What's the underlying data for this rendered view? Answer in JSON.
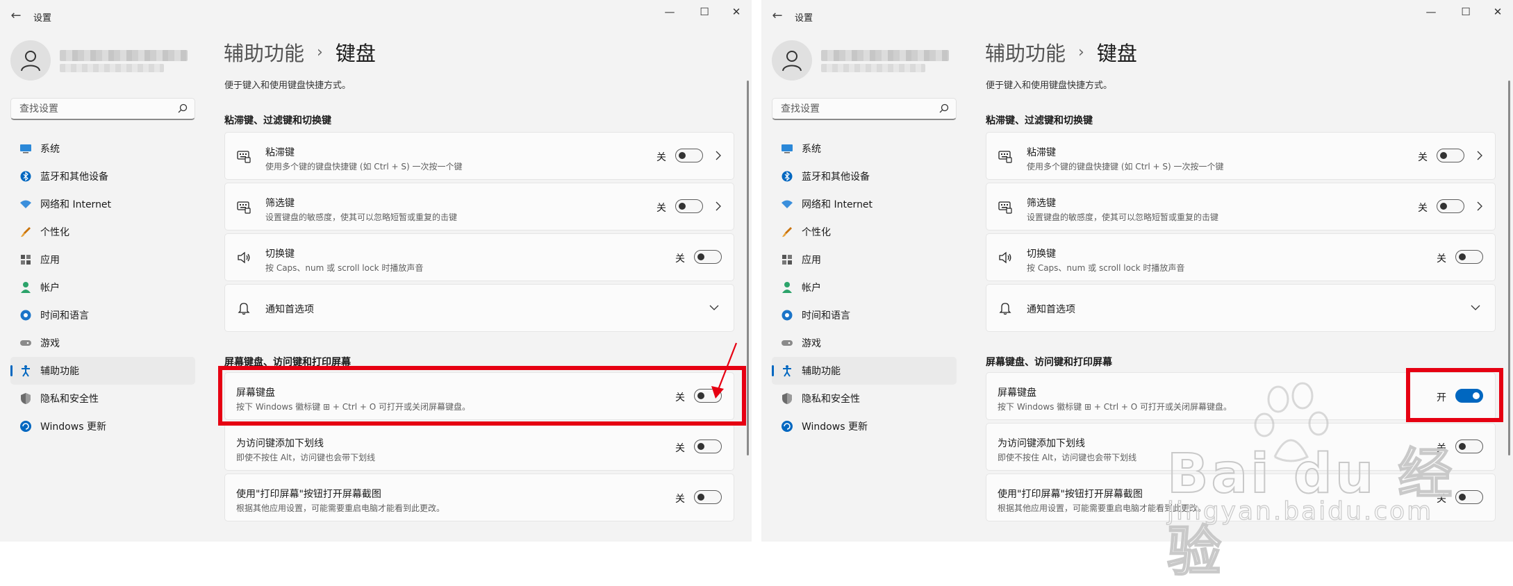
{
  "app": {
    "title": "设置",
    "search_placeholder": "查找设置",
    "nav": [
      {
        "label": "系统",
        "icon": "system-icon"
      },
      {
        "label": "蓝牙和其他设备",
        "icon": "bluetooth-icon"
      },
      {
        "label": "网络和 Internet",
        "icon": "wifi-icon"
      },
      {
        "label": "个性化",
        "icon": "brush-icon"
      },
      {
        "label": "应用",
        "icon": "apps-icon"
      },
      {
        "label": "帐户",
        "icon": "account-icon"
      },
      {
        "label": "时间和语言",
        "icon": "globe-clock-icon"
      },
      {
        "label": "游戏",
        "icon": "gamepad-icon"
      },
      {
        "label": "辅助功能",
        "icon": "accessibility-icon",
        "selected": true
      },
      {
        "label": "隐私和安全性",
        "icon": "shield-icon"
      },
      {
        "label": "Windows 更新",
        "icon": "update-icon"
      }
    ],
    "breadcrumb": {
      "parent": "辅助功能",
      "separator": "›",
      "current": "键盘"
    },
    "description": "便于键入和使用键盘快捷方式。",
    "section1": "粘滞键、过滤键和切换键",
    "section2": "屏幕键盘、访问键和打印屏幕",
    "items1": [
      {
        "title": "粘滞键",
        "sub": "使用多个键的键盘快捷键 (如 Ctrl + S) 一次按一个键",
        "state": "关"
      },
      {
        "title": "筛选键",
        "sub": "设置键盘的敏感度，使其可以忽略短暂或重复的击键",
        "state": "关"
      },
      {
        "title": "切换键",
        "sub": "按 Caps、num 或 scroll lock 时播放声音",
        "state": "关"
      },
      {
        "title": "通知首选项"
      }
    ],
    "items2_left": [
      {
        "title": "屏幕键盘",
        "sub": "按下 Windows 徽标键 ⊞ + Ctrl + O 可打开或关闭屏幕键盘。",
        "state": "关"
      },
      {
        "title": "为访问键添加下划线",
        "sub": "即使不按住 Alt，访问键也会带下划线",
        "state": "关"
      },
      {
        "title": "使用\"打印屏幕\"按钮打开屏幕截图",
        "sub": "根据其他应用设置，可能需要重启电脑才能看到此更改。",
        "state": "关"
      }
    ],
    "items2_right": [
      {
        "title": "屏幕键盘",
        "sub": "按下 Windows 徽标键 ⊞ + Ctrl + O 可打开或关闭屏幕键盘。",
        "state": "开"
      },
      {
        "title": "为访问键添加下划线",
        "sub": "即使不按住 Alt，访问键也会带下划线",
        "state": "关"
      },
      {
        "title": "使用\"打印屏幕\"按钮打开屏幕截图",
        "sub": "根据其他应用设置，可能需要重启电脑才能看到此更改。",
        "state": "关"
      }
    ]
  },
  "watermark": {
    "text": "Bai du 经验",
    "url": "jingyan.baidu.com"
  },
  "colors": {
    "accent": "#0067c0",
    "highlight": "#e60012"
  }
}
